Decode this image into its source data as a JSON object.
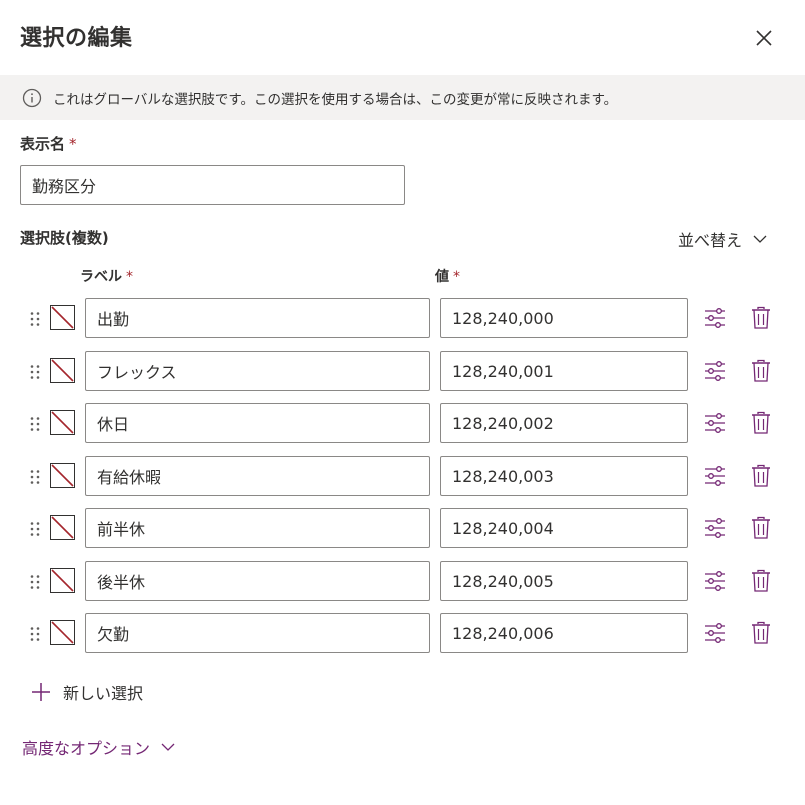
{
  "header": {
    "title": "選択の編集"
  },
  "info": {
    "text": "これはグローバルな選択肢です。この選択を使用する場合は、この変更が常に反映されます。"
  },
  "display_name": {
    "label": "表示名",
    "required_mark": "*",
    "value": "勤務区分"
  },
  "choices": {
    "label": "選択肢(複数)",
    "sort_label": "並べ替え",
    "col_label": "ラベル",
    "col_value": "値",
    "required_mark": "*",
    "items": [
      {
        "label": "出勤",
        "value": "128,240,000"
      },
      {
        "label": "フレックス",
        "value": "128,240,001"
      },
      {
        "label": "休日",
        "value": "128,240,002"
      },
      {
        "label": "有給休暇",
        "value": "128,240,003"
      },
      {
        "label": "前半休",
        "value": "128,240,004"
      },
      {
        "label": "後半休",
        "value": "128,240,005"
      },
      {
        "label": "欠勤",
        "value": "128,240,006"
      }
    ],
    "new_choice_label": "新しい選択"
  },
  "advanced": {
    "label": "高度なオプション"
  },
  "colors": {
    "accent": "#742774",
    "required": "#a4262c",
    "info_bg": "#f3f2f1",
    "no_color_slash": "#a4262c"
  },
  "icons": {
    "close": "close-icon",
    "info": "info-icon",
    "sort": "chevron-down-icon",
    "drag": "drag-handle-icon",
    "settings": "settings-sliders-icon",
    "delete": "trash-icon",
    "add": "plus-icon",
    "swatch": "no-color-icon"
  }
}
